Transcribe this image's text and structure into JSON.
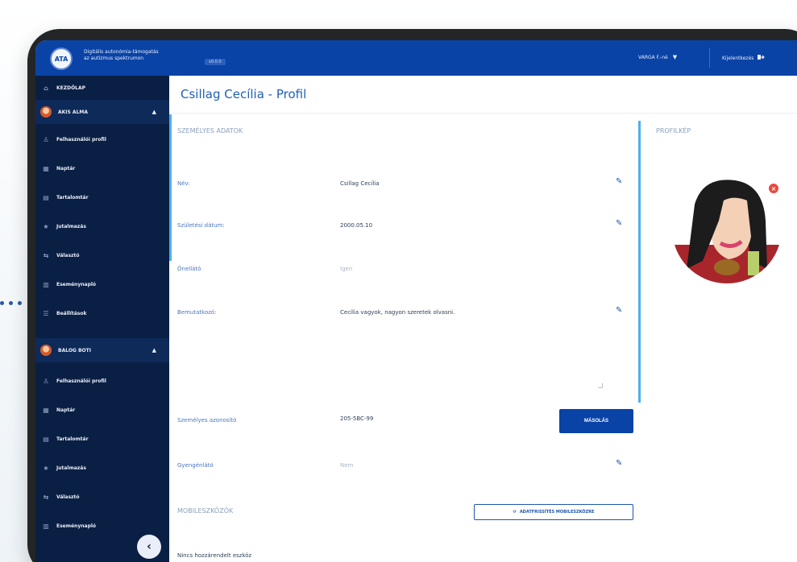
{
  "topbar": {
    "brand_line1": "Digitális autonómia-támogatás",
    "brand_line2": "az autizmus spektrumon",
    "version": "v0.0.0",
    "user": "VARGA F.-né",
    "logout": "Kijelentkezés",
    "logo": "ATA"
  },
  "sidebar": {
    "home": "KEZDŐLAP",
    "sections": [
      {
        "name": "AKIS ALMA",
        "items": [
          "Felhasználói profil",
          "Naptár",
          "Tartalomtár",
          "Jutalmazás",
          "Választó",
          "Eseménynapló",
          "Beállítások"
        ]
      },
      {
        "name": "BALOG BOTI",
        "items": [
          "Felhasználói profil",
          "Naptár",
          "Tartalomtár",
          "Jutalmazás",
          "Választó",
          "Eseménynapló"
        ]
      }
    ]
  },
  "main": {
    "title": "Csillag Cecília - Profil",
    "personal_header": "SZEMÉLYES ADATOK",
    "profile_pic_header": "PROFILKÉP",
    "fields": [
      {
        "label": "Név:",
        "value": "Csillag Cecília"
      },
      {
        "label": "Születési dátum:",
        "value": "2000.05.10"
      },
      {
        "label": "Önellátó",
        "value": "Igen"
      },
      {
        "label": "Bemutatkozó:",
        "value": "Cecília vagyok, nagyon szeretek olvasni."
      },
      {
        "label": "Személyes azonosító",
        "value": "205-5BC-99"
      },
      {
        "label": "Gyengénlátó",
        "value": "Nem"
      }
    ],
    "copy_button": "MÁSOLÁS",
    "mobile_header": "MOBILESZKÖZÖK",
    "update_button": "ADATFRISSÍTÉS MOBILESZKÖZRE",
    "no_device": "Nincs hozzárendelt eszköz"
  },
  "colors": {
    "topbar": "#0a43a6",
    "sidebar": "#0a1f44",
    "accent": "#4db0f0",
    "title": "#1f5fb5"
  }
}
